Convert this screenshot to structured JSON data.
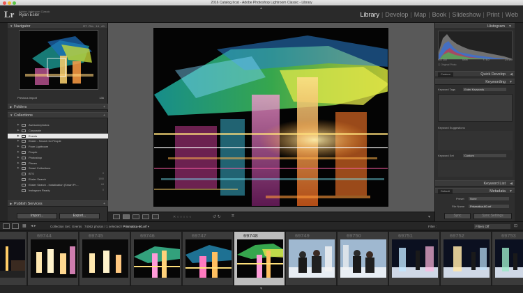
{
  "window": {
    "title": "2016 Catalog.lrcat - Adobe Photoshop Lightroom Classic - Library"
  },
  "identity": {
    "logo": "Lr",
    "product": "Adobe Lightroom Classic",
    "user": "Ryan Esler"
  },
  "modules": [
    "Library",
    "Develop",
    "Map",
    "Book",
    "Slideshow",
    "Print",
    "Web"
  ],
  "navigator": {
    "title": "Navigator",
    "zooms": [
      "FIT",
      "FILL",
      "1:1",
      "4:1"
    ]
  },
  "catalog_row": {
    "label": "Previous Import",
    "count": "136"
  },
  "sections": {
    "folders": "Folders",
    "collections": "Collections",
    "publish": "Publish Services"
  },
  "collections": [
    {
      "label": "Awesomephotos",
      "count": ""
    },
    {
      "label": "Corporate",
      "count": ""
    },
    {
      "label": "Events",
      "count": "",
      "selected": true
    },
    {
      "label": "Eksler - Search for People",
      "count": ""
    },
    {
      "label": "From Lightroom",
      "count": ""
    },
    {
      "label": "People",
      "count": ""
    },
    {
      "label": "Photoshop",
      "count": ""
    },
    {
      "label": "Places",
      "count": ""
    },
    {
      "label": "Smart Collections",
      "count": ""
    },
    {
      "label": "BTS",
      "count": "0"
    },
    {
      "label": "Eksler Search",
      "count": "1000"
    },
    {
      "label": "Eksler Search - Instalization (Smart Pr…",
      "count": "64"
    },
    {
      "label": "Instagram Ready",
      "count": "0"
    }
  ],
  "buttons": {
    "import": "Import...",
    "export": "Export...",
    "sync": "Sync",
    "sync_settings": "Sync Settings"
  },
  "histogram": {
    "title": "Histogram",
    "original_label": "Original Photo",
    "readout": [
      "ISO 200",
      "6mm",
      "f / 8.0",
      "1/4 sec"
    ]
  },
  "right_panels": {
    "quick_develop": "Quick Develop",
    "quick_develop_preset": "Custom",
    "keywording": "Keywording",
    "keyword_tags_label": "Keyword Tags",
    "keyword_tags_value": "Enter Keywords",
    "keyword_suggestions": "Keyword Suggestions",
    "keyword_set_label": "Keyword Set",
    "keyword_set_value": "Custom",
    "keyword_list": "Keyword List",
    "metadata": "Metadata",
    "metadata_preset_label": "Default",
    "metadata_preset_row": "Preset",
    "metadata_preset_value": "None",
    "file_name_label": "File Name",
    "file_name_value": "Prismatica-60.orf"
  },
  "filmstrip_bar": {
    "source": "Collection Set : Events",
    "count_text": "74062 photos / 1 selected /",
    "selected_file": "Prismatica-60.orf",
    "filter_label": "Filter :",
    "filter_value": "Filters Off"
  },
  "thumbnails": [
    {
      "num": "",
      "style": "street"
    },
    {
      "num": "69744",
      "style": "pillars"
    },
    {
      "num": "69745",
      "style": "pillars2"
    },
    {
      "num": "69746",
      "style": "streak"
    },
    {
      "num": "69747",
      "style": "streak2"
    },
    {
      "num": "69748",
      "style": "streak3",
      "selected": true
    },
    {
      "num": "69749",
      "style": "people"
    },
    {
      "num": "69750",
      "style": "people2"
    },
    {
      "num": "69751",
      "style": "snow"
    },
    {
      "num": "69752",
      "style": "snow2"
    },
    {
      "num": "69753",
      "style": "snow3"
    }
  ],
  "colors": {
    "panel_bg": "#2e2e2e",
    "center_bg": "#595959",
    "active_module": "#e8e8e8",
    "selected_row": "#e8e8e8"
  }
}
